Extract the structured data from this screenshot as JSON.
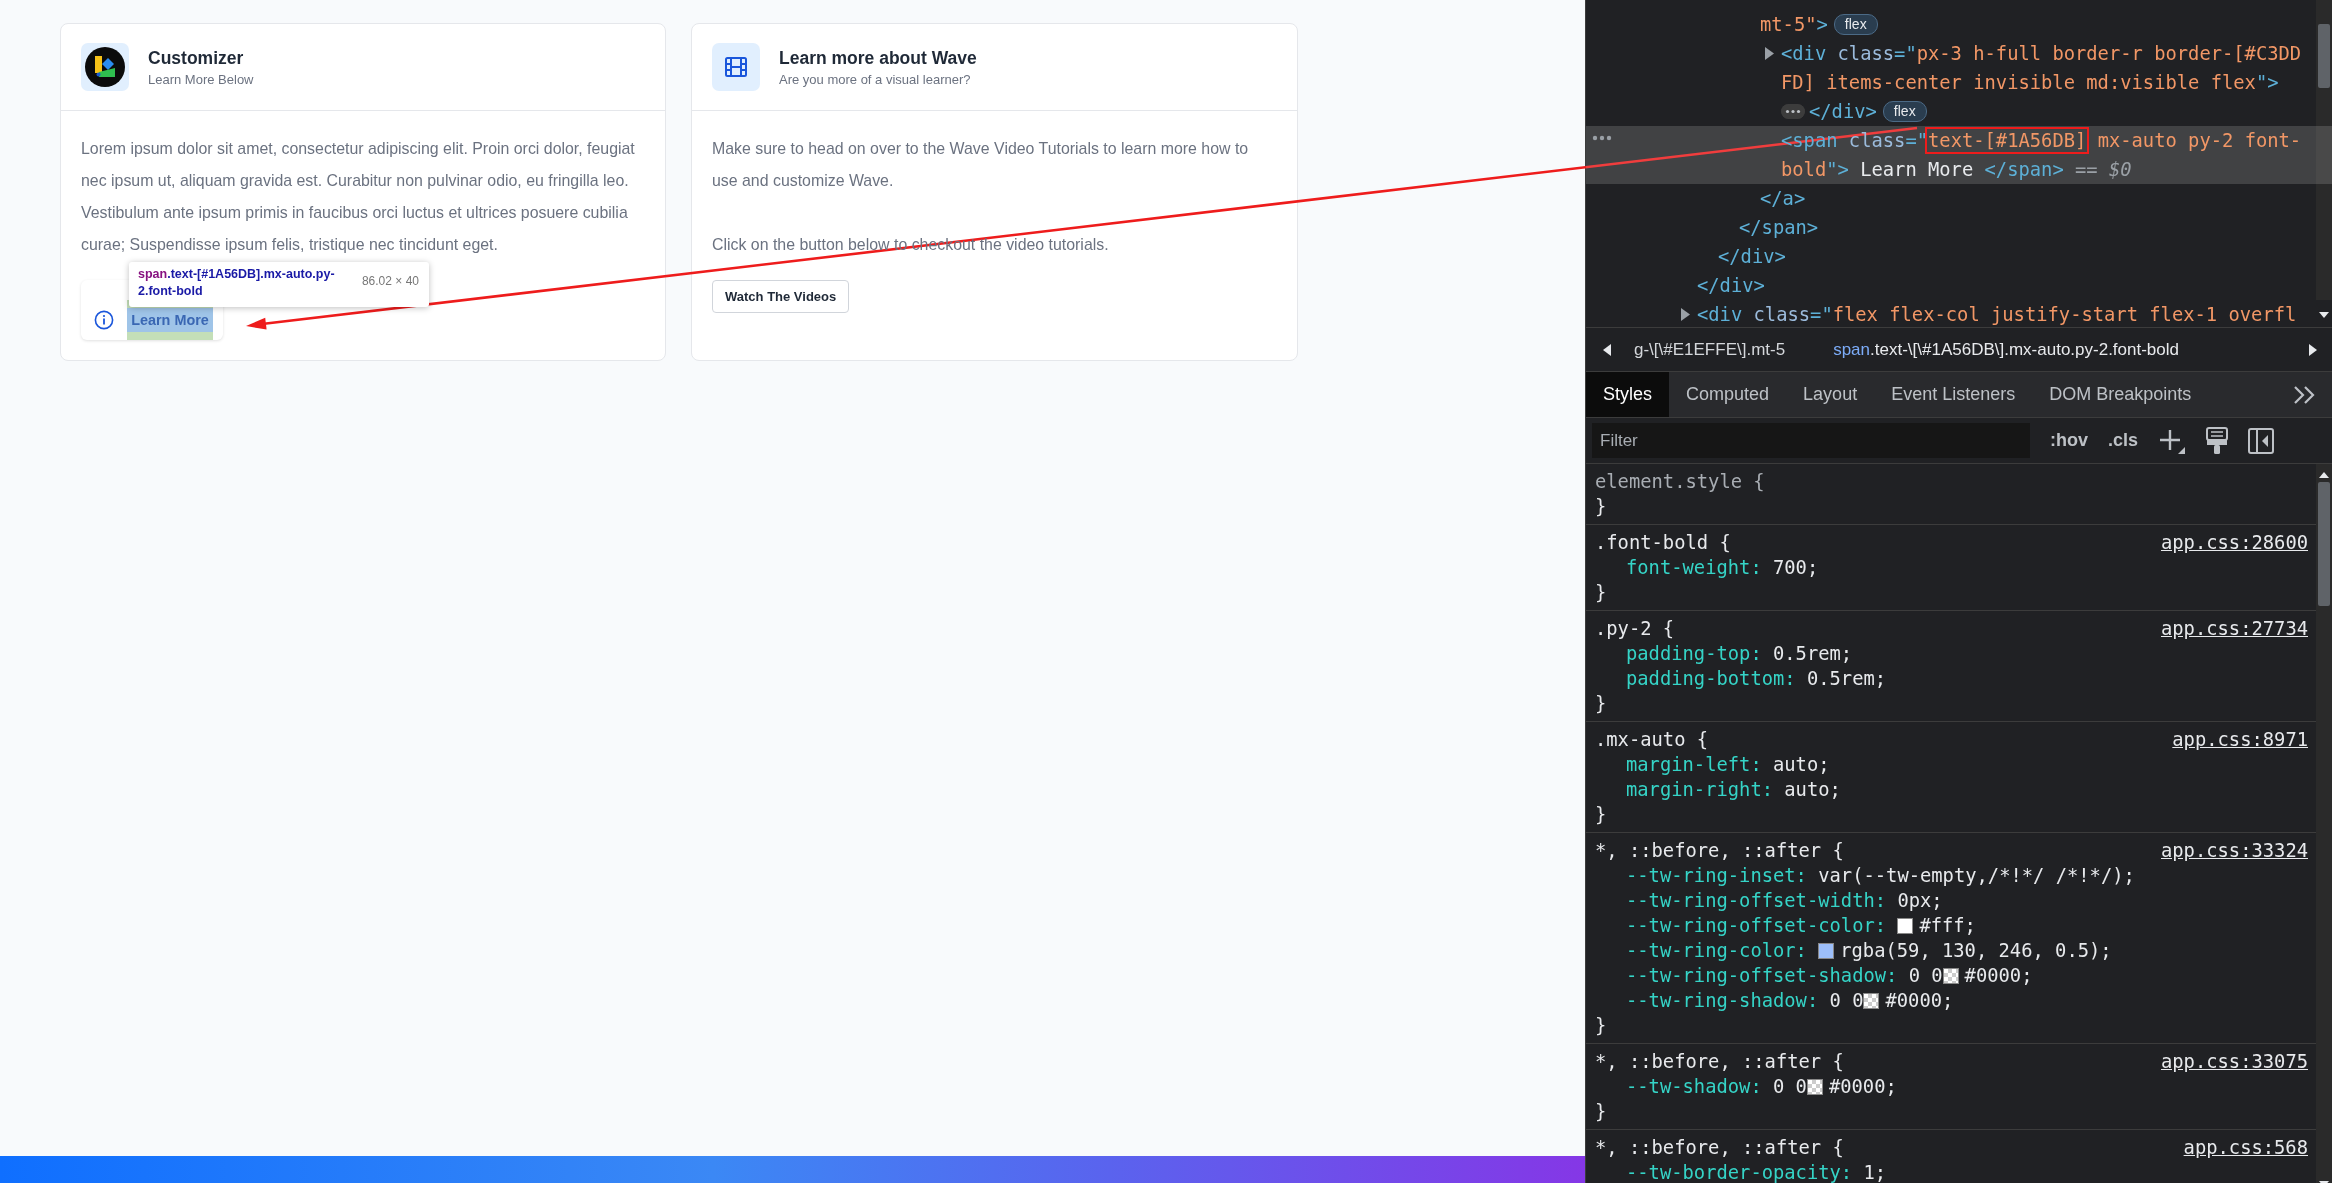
{
  "page": {
    "cards": [
      {
        "title": "Customizer",
        "subtitle": "Learn More Below",
        "paragraphs": [
          "Lorem ipsum dolor sit amet, consectetur adipiscing elit. Proin orci dolor, feugiat nec ipsum ut, aliquam gravida est. Curabitur non pulvinar odio, eu fringilla leo. Vestibulum ante ipsum primis in faucibus orci luctus et ultrices posuere cubilia curae; Suspendisse ipsum felis, tristique nec tincidunt eget."
        ],
        "action": {
          "kind": "link-pill",
          "label": "Learn More",
          "inspected": true
        }
      },
      {
        "title": "Learn more about Wave",
        "subtitle": "Are you more of a visual learner?",
        "paragraphs": [
          "Make sure to head on over to the Wave Video Tutorials to learn more how to use and customize Wave.",
          "Click on the button below to checkout the video tutorials."
        ],
        "action": {
          "kind": "button",
          "label": "Watch The Videos",
          "inspected": false
        }
      }
    ],
    "inspect_tooltip": {
      "tag": "span",
      "classes": ".text-[#1A56DB].mx-auto.py-2.font-bold",
      "size": "86.02 × 40"
    }
  },
  "devtools": {
    "elements": {
      "tree": [
        {
          "close": [
            [
              {
                "kind": "tag",
                "text": "</div>"
              }
            ]
          ],
          "children": [
            {
              "close": [
                [
                  {
                    "kind": "tag",
                    "text": "</div>"
                  }
                ]
              ],
              "children": [
                {
                  "close": [
                    [
                      {
                        "kind": "tag",
                        "text": "</span>"
                      }
                    ]
                  ],
                  "children": [
                    {
                      "selected": false,
                      "open": [
                        [
                          {
                            "kind": "value",
                            "text": "mt-5\""
                          },
                          {
                            "kind": "tag",
                            "text": ">"
                          }
                        ]
                      ],
                      "badge": "flex",
                      "close": [
                        [
                          {
                            "kind": "tag",
                            "text": "</a>"
                          }
                        ]
                      ],
                      "children": [
                        {
                          "selected": false,
                          "expanded": false,
                          "badge": "flex",
                          "open": [
                            [
                              {
                                "kind": "tag",
                                "text": "<div"
                              },
                              {
                                "kind": "attr",
                                "text": " class"
                              },
                              {
                                "kind": "tag",
                                "text": "=\""
                              },
                              {
                                "kind": "value",
                                "text": "px-3 h-full border-r border-[#C3DD"
                              }
                            ],
                            [
                              {
                                "kind": "value",
                                "text": "FD] items-center invisible md:visible flex"
                              },
                              {
                                "kind": "tag",
                                "text": "\">"
                              }
                            ]
                          ],
                          "close": [
                            [
                              {
                                "kind": "tag",
                                "text": "</div>"
                              }
                            ]
                          ]
                        },
                        {
                          "selected": true,
                          "open": [
                            [
                              {
                                "kind": "tag",
                                "text": "<span"
                              },
                              {
                                "kind": "attr",
                                "text": " class"
                              },
                              {
                                "kind": "tag",
                                "text": "=\""
                              },
                              {
                                "kind": "value",
                                "text": "text-[#1A56DB]",
                                "boxed": true
                              },
                              {
                                "kind": "value",
                                "text": " mx-auto py-2 font-"
                              }
                            ],
                            [
                              {
                                "kind": "value",
                                "text": "bold"
                              },
                              {
                                "kind": "tag",
                                "text": "\">"
                              },
                              {
                                "kind": "text",
                                "text": " Learn More "
                              },
                              {
                                "kind": "tag",
                                "text": "</span>"
                              },
                              {
                                "kind": "dim",
                                "text": " == $0"
                              }
                            ]
                          ]
                        }
                      ]
                    }
                  ]
                }
              ]
            }
          ]
        },
        {
          "selected": false,
          "expanded": false,
          "open": [
            [
              {
                "kind": "tag",
                "text": "<div"
              },
              {
                "kind": "attr",
                "text": " class"
              },
              {
                "kind": "tag",
                "text": "=\""
              },
              {
                "kind": "value",
                "text": "flex flex-col justify-start flex-1 overfl"
              }
            ]
          ]
        }
      ]
    },
    "breadcrumbs": [
      {
        "text": "g-\\[\\#E1EFFE\\].mt-5",
        "selected": false
      },
      {
        "tag": "span",
        "text": ".text-\\[\\#1A56DB\\].mx-auto.py-2.font-bold",
        "selected": true
      }
    ],
    "tabs": [
      {
        "label": "Styles",
        "selected": true
      },
      {
        "label": "Computed",
        "selected": false
      },
      {
        "label": "Layout",
        "selected": false
      },
      {
        "label": "Event Listeners",
        "selected": false
      },
      {
        "label": "DOM Breakpoints",
        "selected": false
      }
    ],
    "filter": {
      "placeholder": "Filter"
    },
    "toolbar": [
      ":hov",
      ".cls"
    ],
    "rules": [
      {
        "kind": "inline",
        "selector": "element.style {",
        "close": "}"
      },
      {
        "kind": "class",
        "selector": ".font-bold {",
        "source": "app.css:28600",
        "close": "}",
        "decls": [
          {
            "prop": "font-weight:",
            "value": "700;"
          }
        ]
      },
      {
        "kind": "class",
        "selector": ".py-2 {",
        "source": "app.css:27734",
        "close": "}",
        "decls": [
          {
            "prop": "padding-top:",
            "value": "0.5rem;"
          },
          {
            "prop": "padding-bottom:",
            "value": "0.5rem;"
          }
        ]
      },
      {
        "kind": "class",
        "selector": ".mx-auto {",
        "source": "app.css:8971",
        "close": "}",
        "decls": [
          {
            "prop": "margin-left:",
            "value": "auto;"
          },
          {
            "prop": "margin-right:",
            "value": "auto;"
          }
        ]
      },
      {
        "kind": "universal",
        "selector": "*, ::before, ::after {",
        "source": "app.css:33324",
        "close": "}",
        "decls": [
          {
            "prop": "--tw-ring-inset:",
            "value": "var(--tw-empty,/*!*/ /*!*/);"
          },
          {
            "prop": "--tw-ring-offset-width:",
            "value": "0px;"
          },
          {
            "prop": "--tw-ring-offset-color:",
            "swatch": {
              "kind": "solid",
              "color": "#ffffff"
            },
            "value": "#fff;"
          },
          {
            "prop": "--tw-ring-color:",
            "swatch": {
              "kind": "solid",
              "color": "#9dbffa"
            },
            "value": "rgba(59, 130, 246, 0.5);"
          },
          {
            "prop": "--tw-ring-offset-shadow:",
            "prefix": "0 0",
            "swatch": {
              "kind": "transparent"
            },
            "value": "#0000;"
          },
          {
            "prop": "--tw-ring-shadow:",
            "prefix": "0 0",
            "swatch": {
              "kind": "transparent"
            },
            "value": "#0000;"
          }
        ]
      },
      {
        "kind": "universal",
        "selector": "*, ::before, ::after {",
        "source": "app.css:33075",
        "close": "}",
        "decls": [
          {
            "prop": "--tw-shadow:",
            "prefix": "0 0",
            "swatch": {
              "kind": "transparent"
            },
            "value": "#0000;"
          }
        ]
      },
      {
        "kind": "universal",
        "selector": "*, ::before, ::after {",
        "source": "app.css:568",
        "decls": [
          {
            "prop": "--tw-border-opacity:",
            "value": "1;"
          }
        ]
      }
    ]
  }
}
